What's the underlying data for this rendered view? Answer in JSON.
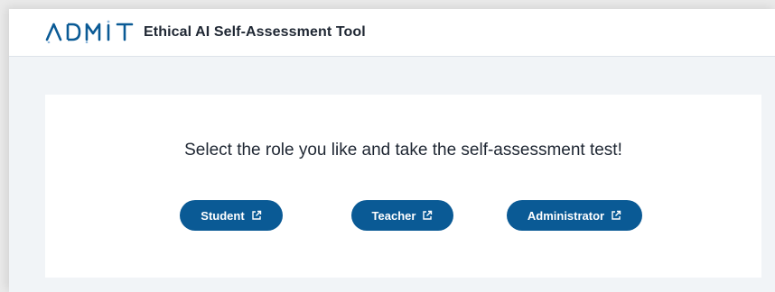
{
  "header": {
    "logo_text": "ADMIT",
    "title": "Ethical AI Self-Assessment Tool"
  },
  "main": {
    "prompt": "Select the role you like and take the self-assessment test!",
    "roles": [
      {
        "label": "Student",
        "icon": "external-link-icon"
      },
      {
        "label": "Teacher",
        "icon": "external-link-icon"
      },
      {
        "label": "Administrator",
        "icon": "external-link-icon"
      }
    ]
  },
  "colors": {
    "accent": "#0a5a95",
    "logo_dots": "#8fb8dc",
    "background": "#f1f4f7"
  }
}
